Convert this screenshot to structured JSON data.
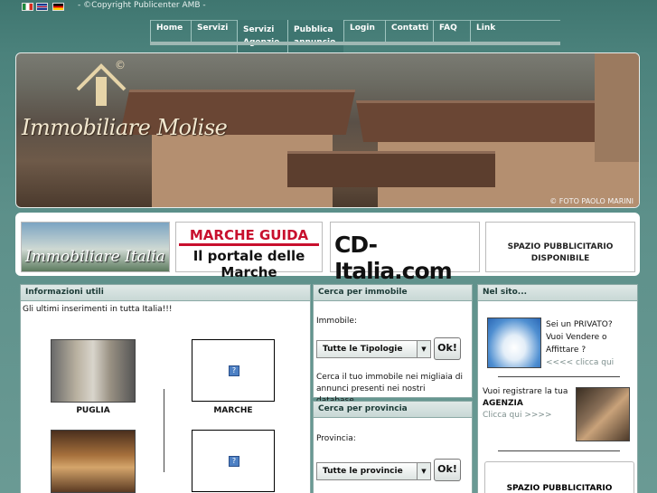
{
  "header": {
    "copyright": "- ©Copyright Publicenter AMB -"
  },
  "nav": {
    "items": [
      {
        "label": "Home"
      },
      {
        "label": "Servizi"
      },
      {
        "label": "Servizi Agenzie"
      },
      {
        "label": "Pubblica annuncio"
      },
      {
        "label": "Login"
      },
      {
        "label": "Contatti"
      },
      {
        "label": "FAQ"
      },
      {
        "label": "Link"
      }
    ]
  },
  "banner": {
    "title": "Immobiliare Molise",
    "copyright_mark": "©",
    "photo_credit": "© FOTO PAOLO MARINI"
  },
  "ads": {
    "ad1": "Immobiliare Italia",
    "ad2_line1": "MARCHE GUIDA",
    "ad2_line2": "Il portale delle Marche",
    "ad3": "CD-Italia.com",
    "ad4_line1": "SPAZIO PUBBLICITARIO",
    "ad4_line2": "DISPONIBILE"
  },
  "info": {
    "title": "Informazioni utili",
    "intro": "Gli ultimi inserimenti in tutta Italia!!!",
    "listings": [
      {
        "caption": "PUGLIA"
      },
      {
        "caption": "MARCHE"
      }
    ]
  },
  "search": {
    "title": "Cerca per immobile",
    "label": "Immobile:",
    "select": "Tutte le Tipologie",
    "ok": "Ok!",
    "note": "Cerca il tuo immobile nei migliaia di annunci presenti nei nostri database...."
  },
  "province": {
    "title": "Cerca per provincia",
    "label": "Provincia:",
    "select": "Tutte le provincie",
    "ok": "Ok!"
  },
  "site": {
    "title": "Nel sito...",
    "private_q": "Sei un PRIVATO?",
    "private_text": "Vuoi Vendere o Affittare ?",
    "private_link": "<<<< clicca qui",
    "agency_text": "Vuoi registrare la tua",
    "agency_word": "AGENZIA",
    "agency_link": "Clicca qui >>>>",
    "ad_space": "SPAZIO PUBBLICITARIO"
  },
  "colors": {
    "background": "#5d908a",
    "panel_header": "#c8d8d5",
    "accent_red": "#c8102e"
  }
}
